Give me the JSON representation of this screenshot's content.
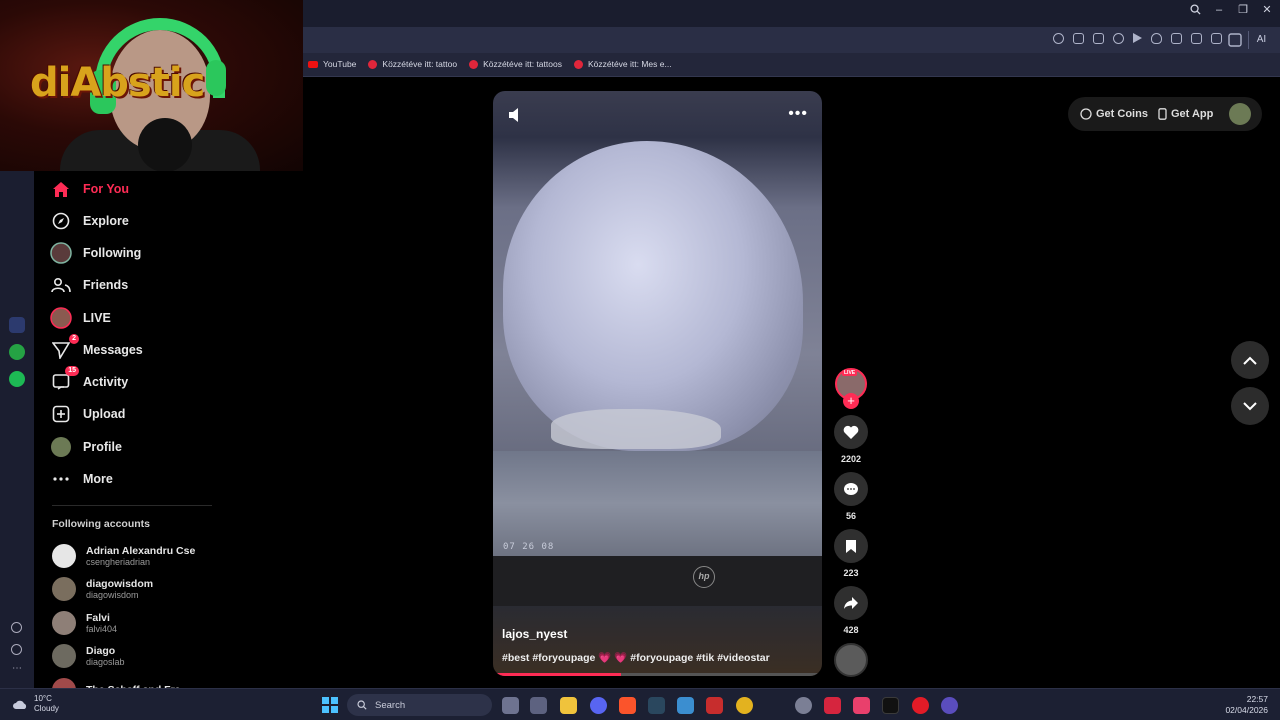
{
  "bookmarks": [
    {
      "label": "YouTube",
      "type": "youtube"
    },
    {
      "label": "Közzétéve itt: tattoo",
      "type": "pinterest"
    },
    {
      "label": "Közzétéve itt: tattoos",
      "type": "pinterest"
    },
    {
      "label": "Közzétéve itt: Mes e...",
      "type": "pinterest"
    }
  ],
  "address_bar": {
    "ai_label": "AI"
  },
  "webcam": {
    "overlay_text": "diAbstic"
  },
  "sidebar": {
    "nav": [
      {
        "label": "For You",
        "icon": "home-icon",
        "active": true
      },
      {
        "label": "Explore",
        "icon": "compass-icon"
      },
      {
        "label": "Following",
        "icon": "following-avatar-icon"
      },
      {
        "label": "Friends",
        "icon": "friends-icon"
      },
      {
        "label": "LIVE",
        "icon": "live-avatar-icon"
      },
      {
        "label": "Messages",
        "icon": "send-icon",
        "badge": "2"
      },
      {
        "label": "Activity",
        "icon": "inbox-icon",
        "badge": "15"
      },
      {
        "label": "Upload",
        "icon": "plus-square-icon"
      },
      {
        "label": "Profile",
        "icon": "profile-avatar-icon"
      },
      {
        "label": "More",
        "icon": "ellipsis-icon"
      }
    ],
    "following_heading": "Following accounts",
    "accounts": [
      {
        "name": "Adrian Alexandru Cse",
        "username": "csengheriadrian"
      },
      {
        "name": "diagowisdom",
        "username": "diagowisdom"
      },
      {
        "name": "Falvi",
        "username": "falvi404"
      },
      {
        "name": "Diago",
        "username": "diagoslab"
      },
      {
        "name": "The Schaff and Fre",
        "username": ""
      }
    ]
  },
  "video": {
    "author": "lajos_nyest",
    "caption": "#best #foryoupage 💗 💗 #foryoupage #tik #videostar",
    "timestamp_overlay": "07 26 08",
    "logo_text": "hp",
    "progress": 0.39
  },
  "actions": {
    "live_tag": "LIVE",
    "likes": "2202",
    "comments": "56",
    "saves": "223",
    "shares": "428"
  },
  "top_right": {
    "coins_label": "Get Coins",
    "app_label": "Get App"
  },
  "taskbar": {
    "temperature": "10°C",
    "condition": "Cloudy",
    "search_placeholder": "Search",
    "time": "22:57",
    "date": "02/04/2026"
  },
  "colors": {
    "accent": "#fe2c55",
    "taskbar": "#1c2033",
    "browser_chrome": "#2a2e45"
  }
}
